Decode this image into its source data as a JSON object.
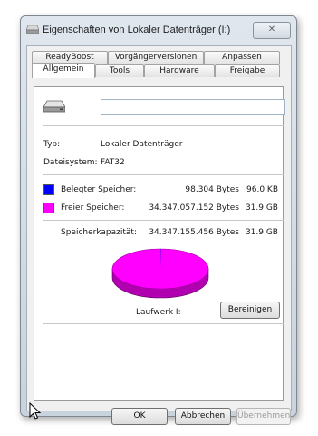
{
  "window": {
    "title": "Eigenschaften von Lokaler Datenträger (I:)",
    "close_glyph": "✕"
  },
  "tabs": {
    "row1": [
      "ReadyBoost",
      "Vorgängerversionen",
      "Anpassen"
    ],
    "row2": [
      "Allgemein",
      "Tools",
      "Hardware",
      "Freigabe"
    ],
    "active": "Allgemein"
  },
  "general": {
    "drive_name_value": "",
    "type_label": "Typ:",
    "type_value": "Lokaler Datenträger",
    "fs_label": "Dateisystem:",
    "fs_value": "FAT32",
    "used": {
      "label": "Belegter Speicher:",
      "bytes": "98.304 Bytes",
      "size": "96.0 KB",
      "color": "#0000ff"
    },
    "free": {
      "label": "Freier Speicher:",
      "bytes": "34.347.057.152 Bytes",
      "size": "31.9 GB",
      "color": "#ff00ff"
    },
    "capacity": {
      "label": "Speicherkapazität:",
      "bytes": "34.347.155.456 Bytes",
      "size": "31.9 GB"
    },
    "drive_label": "Laufwerk I:",
    "cleanup_button": "Bereinigen",
    "pie": {
      "used_fraction": 2.9e-06,
      "free_fraction": 0.9999971
    }
  },
  "footer": {
    "ok": "OK",
    "cancel": "Abbrechen",
    "apply": "Übernehmen"
  }
}
